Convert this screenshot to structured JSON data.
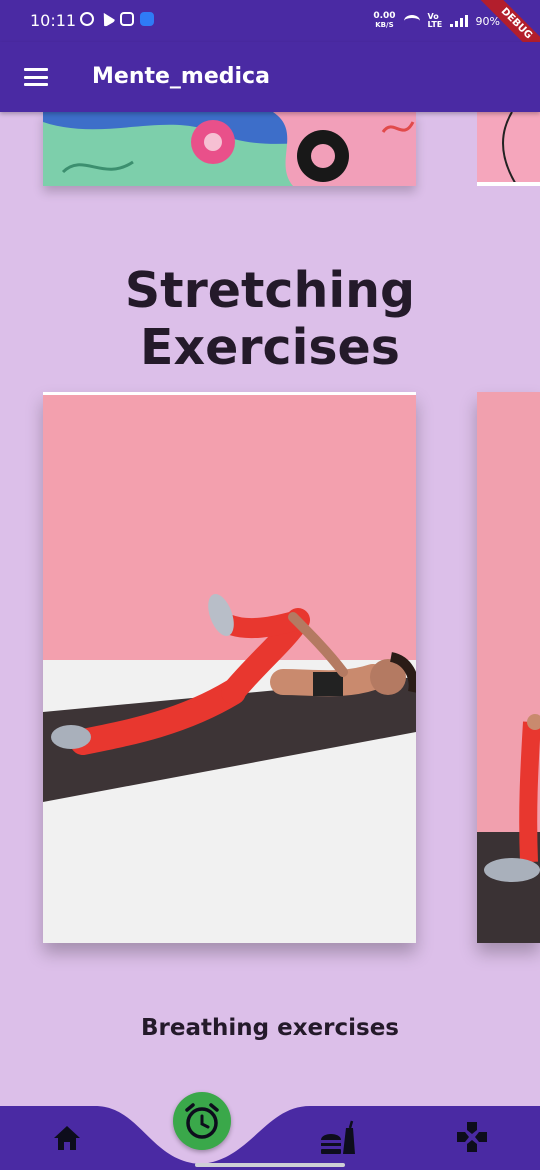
{
  "status_bar": {
    "time": "10:11",
    "net_speed_value": "0.00",
    "net_speed_unit": "KB/S",
    "volte": "Vo LTE",
    "battery": "90%",
    "debug_label": "DEBUG"
  },
  "appbar": {
    "title": "Mente_medica",
    "menu_icon": "menu-icon"
  },
  "section": {
    "title": "Stretching Exercises"
  },
  "cards": [
    {
      "caption": "Breathing exercises"
    }
  ],
  "bottom_nav": {
    "items": [
      {
        "icon": "home-icon"
      },
      {
        "icon": "alarm-clock-icon"
      },
      {
        "icon": "food-icon"
      },
      {
        "icon": "gamepad-icon"
      }
    ],
    "active_index": 1,
    "colors": {
      "bar": "#4a2aa3",
      "active": "#3aa84a",
      "notch": "#ffffff"
    }
  },
  "colors": {
    "primary": "#4a2aa3",
    "background": "#dcbfe9"
  }
}
